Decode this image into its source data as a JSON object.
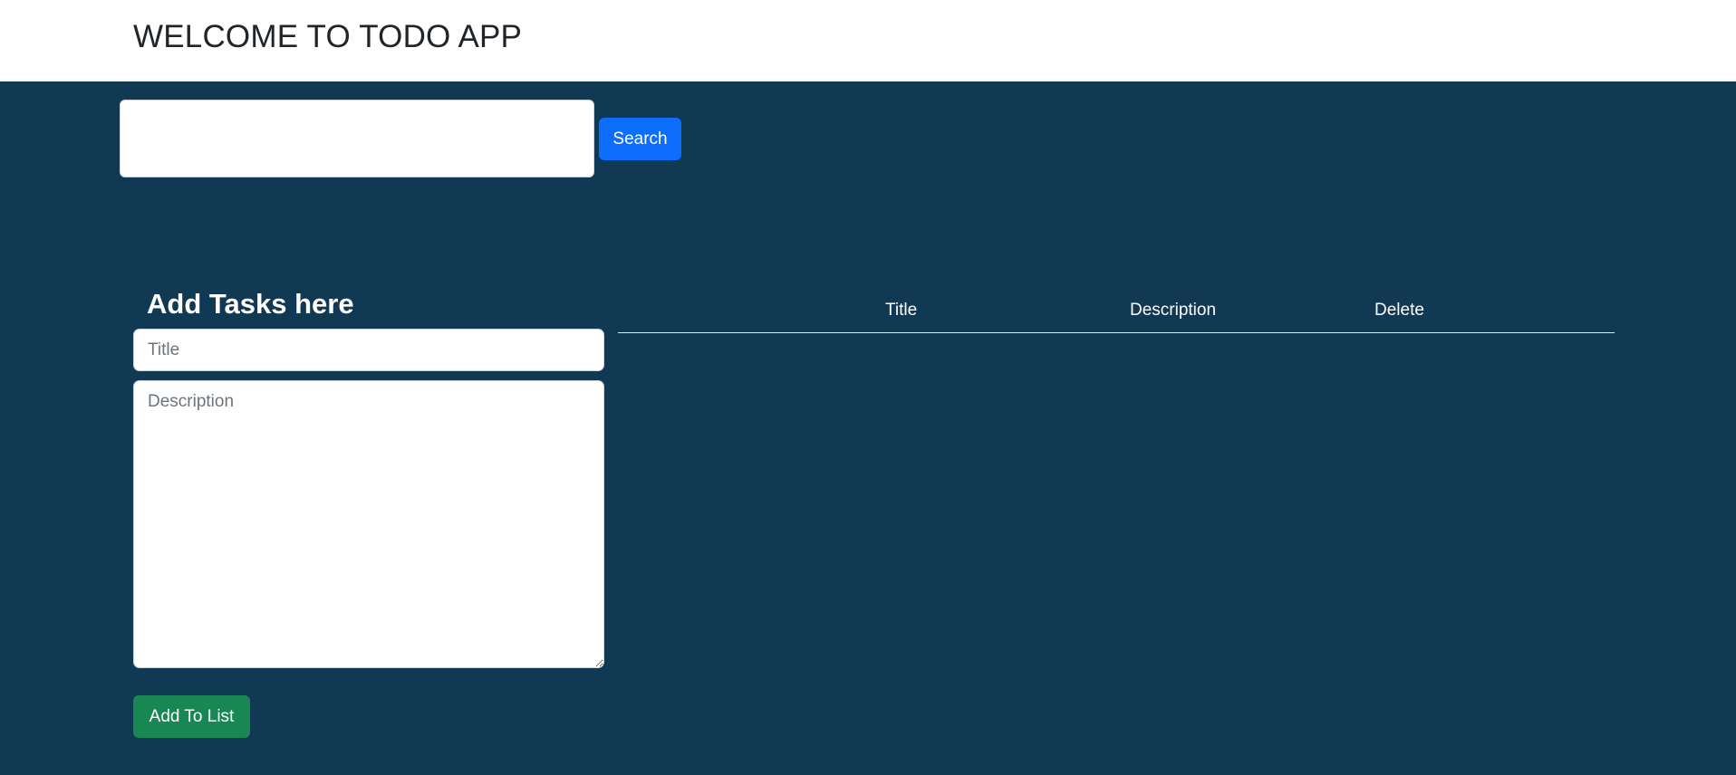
{
  "header": {
    "title": "WELCOME TO TODO APP"
  },
  "search": {
    "value": "",
    "placeholder": "",
    "button_label": "Search"
  },
  "form": {
    "heading": "Add Tasks here",
    "title_placeholder": "Title",
    "title_value": "",
    "description_placeholder": "Description",
    "description_value": "",
    "submit_label": "Add To List"
  },
  "table": {
    "columns": [
      "Title",
      "Description",
      "Delete"
    ],
    "rows": []
  },
  "colors": {
    "background": "#123954",
    "header_background": "#ffffff",
    "primary_button": "#0d6efd",
    "success_button": "#198754"
  }
}
